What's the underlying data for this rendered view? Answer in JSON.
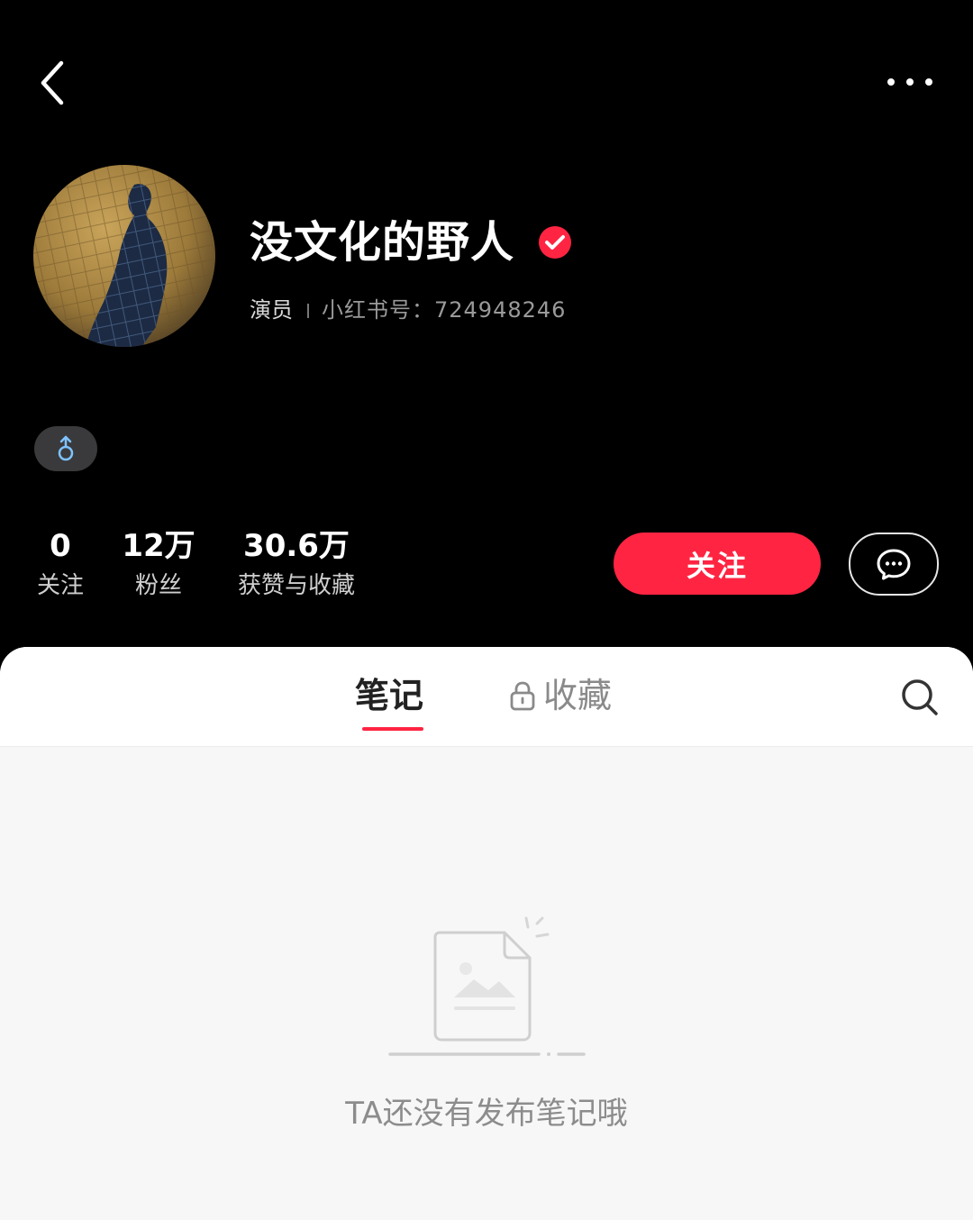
{
  "profile": {
    "name": "没文化的野人",
    "occupation": "演员",
    "red_id_label": "小红书号：",
    "red_id": "724948246",
    "gender_icon": "male-icon",
    "verified_icon": "verified-check-icon"
  },
  "stats": [
    {
      "value": "0",
      "label": "关注"
    },
    {
      "value": "12万",
      "label": "粉丝"
    },
    {
      "value": "30.6万",
      "label": "获赞与收藏"
    }
  ],
  "actions": {
    "follow_label": "关注",
    "chat_icon": "chat-bubble-icon"
  },
  "tabs": {
    "notes": "笔记",
    "favorites": "收藏"
  },
  "empty_state": {
    "message": "TA还没有发布笔记哦"
  },
  "colors": {
    "accent": "#ff2442",
    "header_bg": "#000000",
    "content_bg": "#f7f7f7"
  }
}
